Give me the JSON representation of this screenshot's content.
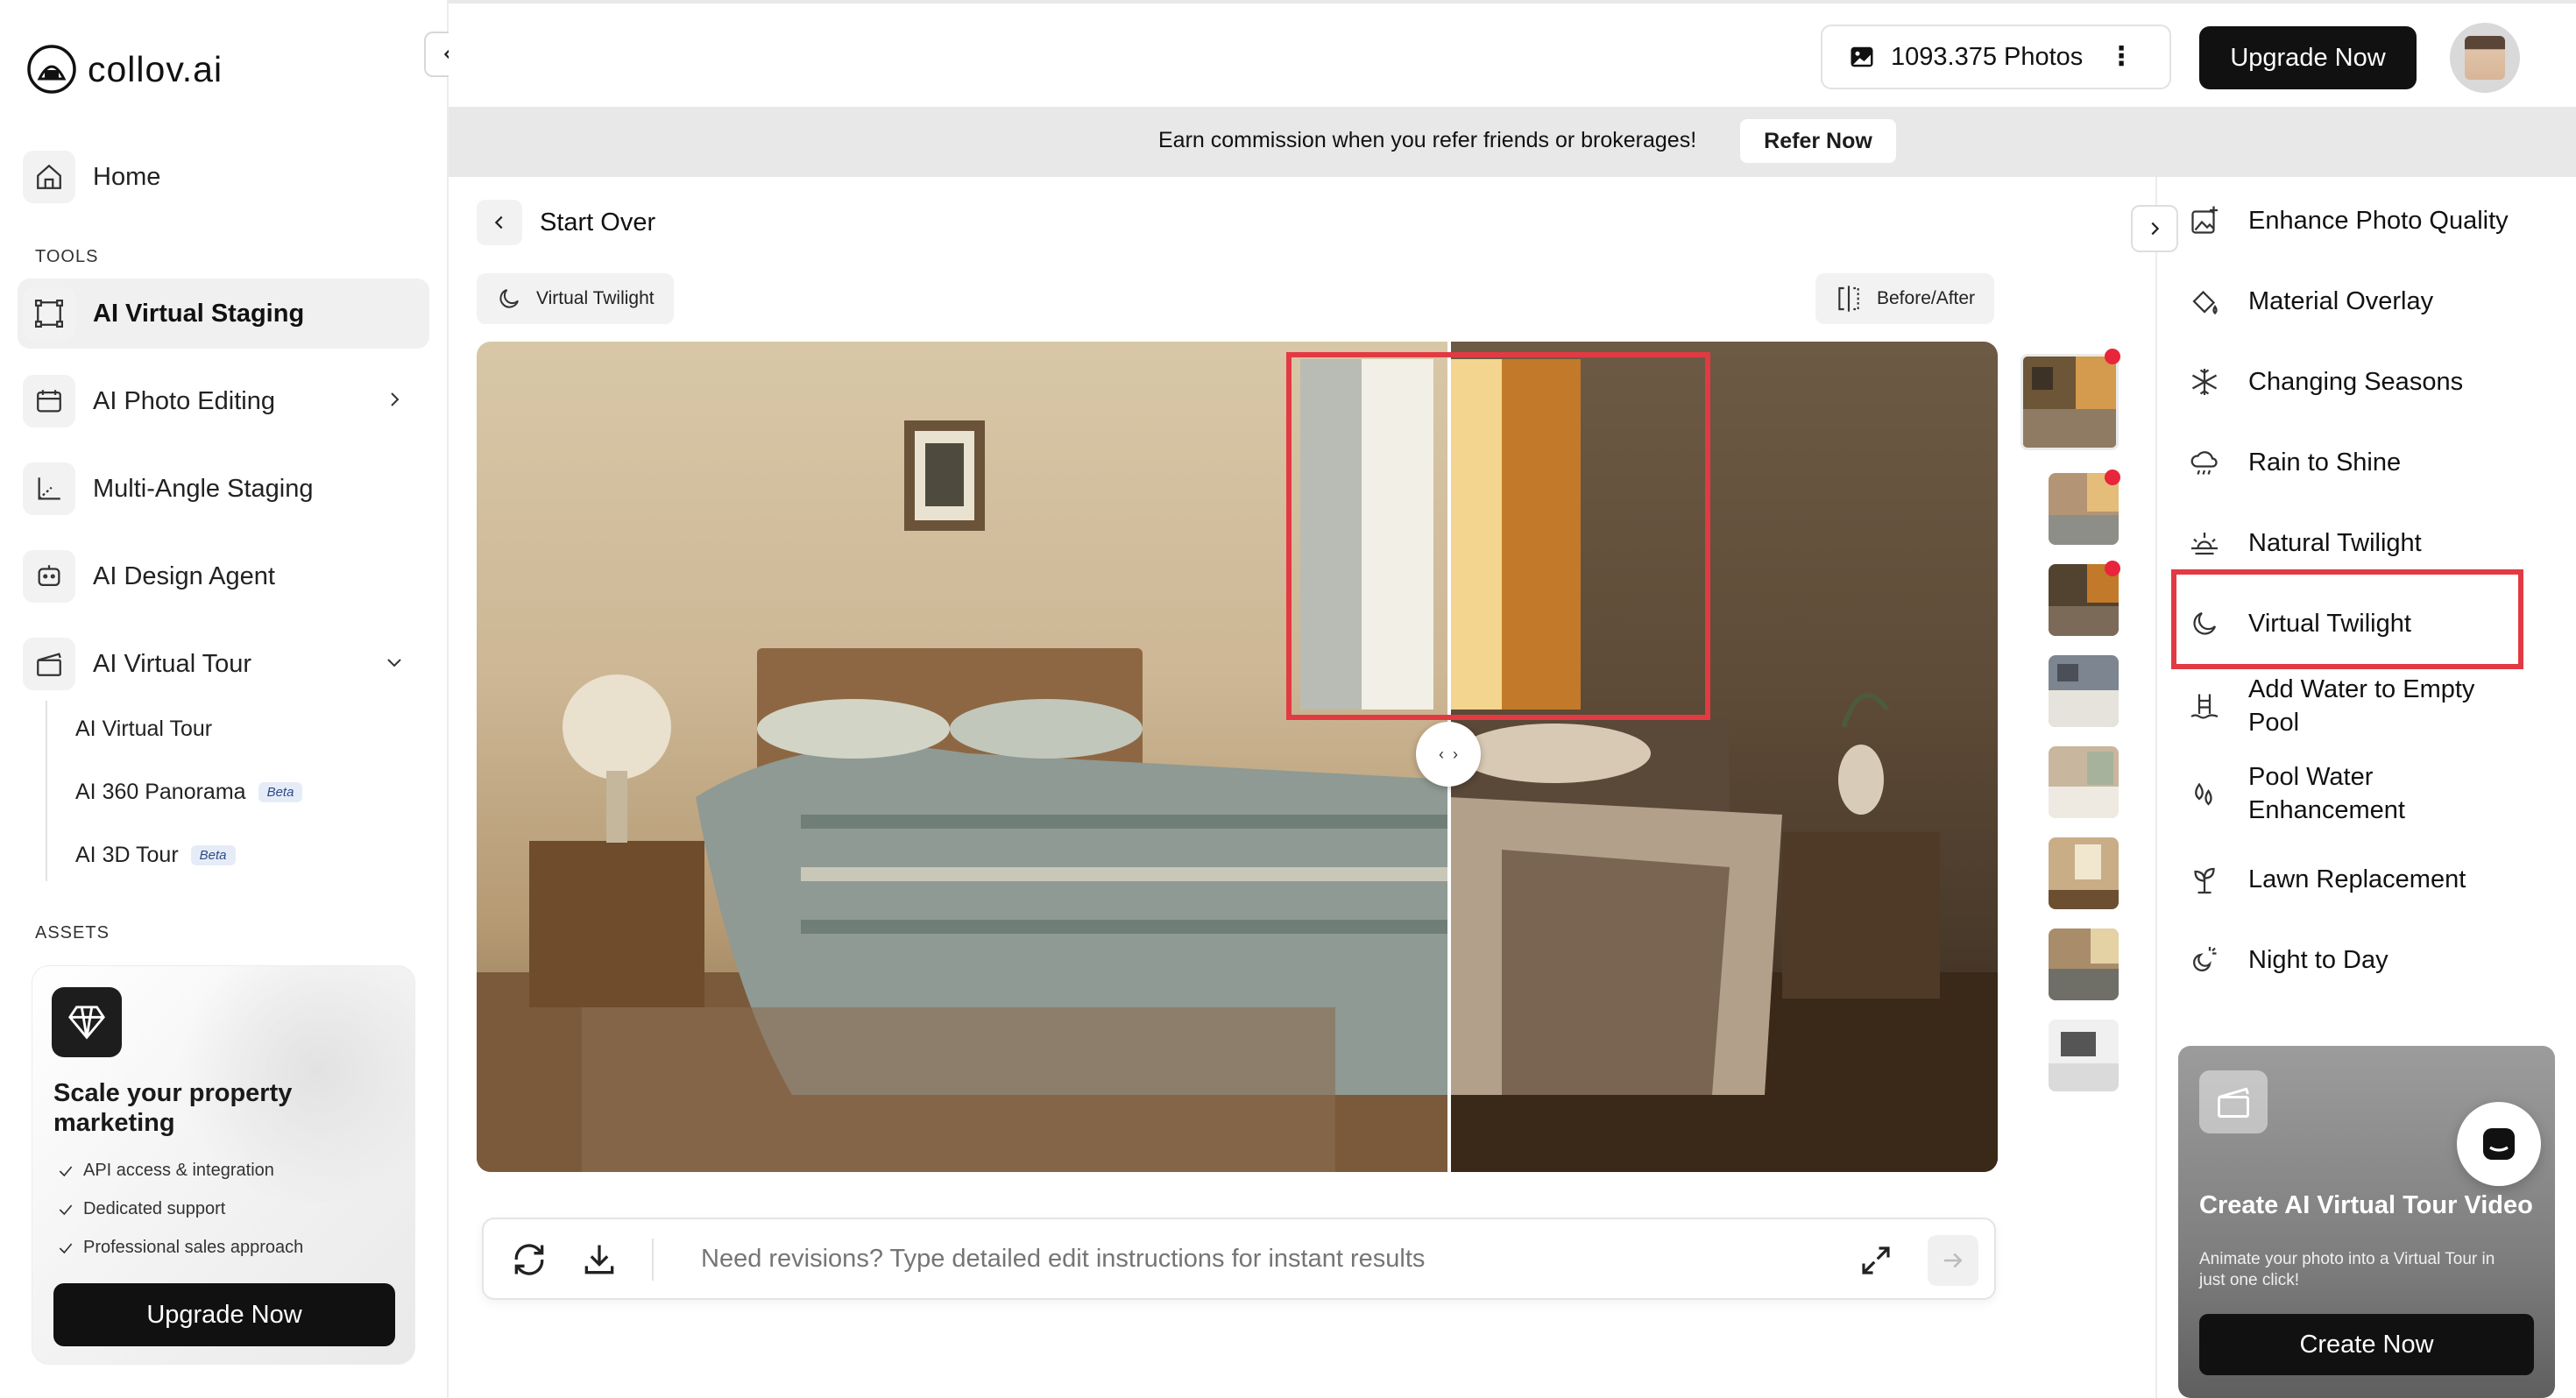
{
  "brand": {
    "name": "collov.ai"
  },
  "sidebar": {
    "home_label": "Home",
    "tools_heading": "TOOLS",
    "tools": [
      {
        "label": "AI Virtual Staging",
        "active": true
      },
      {
        "label": "AI Photo Editing"
      },
      {
        "label": "Multi-Angle Staging"
      },
      {
        "label": "AI Design Agent"
      },
      {
        "label": "AI Virtual Tour"
      }
    ],
    "tour_sub": [
      {
        "label": "AI Virtual Tour"
      },
      {
        "label": "AI 360 Panorama",
        "badge": "Beta"
      },
      {
        "label": "AI 3D Tour",
        "badge": "Beta"
      }
    ],
    "assets_heading": "ASSETS",
    "promo": {
      "title": "Scale your property marketing",
      "features": [
        "API access & integration",
        "Dedicated support",
        "Professional sales approach"
      ],
      "button": "Upgrade Now"
    }
  },
  "topbar": {
    "photos": "1093.375 Photos",
    "upgrade": "Upgrade Now"
  },
  "banner": {
    "text": "Earn commission when you refer friends or brokerages!",
    "button": "Refer Now"
  },
  "main": {
    "back_label": "Start Over",
    "mode_tag": "Virtual Twilight",
    "compare_tag": "Before/After",
    "prompt_placeholder": "Need revisions? Type detailed edit instructions for instant results"
  },
  "tools_panel": {
    "items": [
      {
        "label": "Enhance Photo Quality",
        "icon": "enhance-icon"
      },
      {
        "label": "Material Overlay",
        "icon": "paint-bucket-icon"
      },
      {
        "label": "Changing Seasons",
        "icon": "snowflake-icon"
      },
      {
        "label": "Rain to Shine",
        "icon": "cloud-rain-icon"
      },
      {
        "label": "Natural Twilight",
        "icon": "sunset-icon"
      },
      {
        "label": "Virtual Twilight",
        "icon": "moon-icon",
        "selected": true
      },
      {
        "label": "Add Water to Empty Pool",
        "icon": "pool-ladder-icon"
      },
      {
        "label": "Pool Water Enhancement",
        "icon": "water-drops-icon"
      },
      {
        "label": "Lawn Replacement",
        "icon": "sprout-icon"
      },
      {
        "label": "Night to Day",
        "icon": "sun-moon-icon"
      }
    ],
    "tour_card": {
      "title": "Create AI Virtual Tour Video",
      "desc": "Animate your photo into a Virtual Tour in just one click!",
      "button": "Create Now"
    }
  },
  "colors": {
    "highlight": "#e23a43",
    "primary": "#111111",
    "notification": "#e8253a"
  }
}
